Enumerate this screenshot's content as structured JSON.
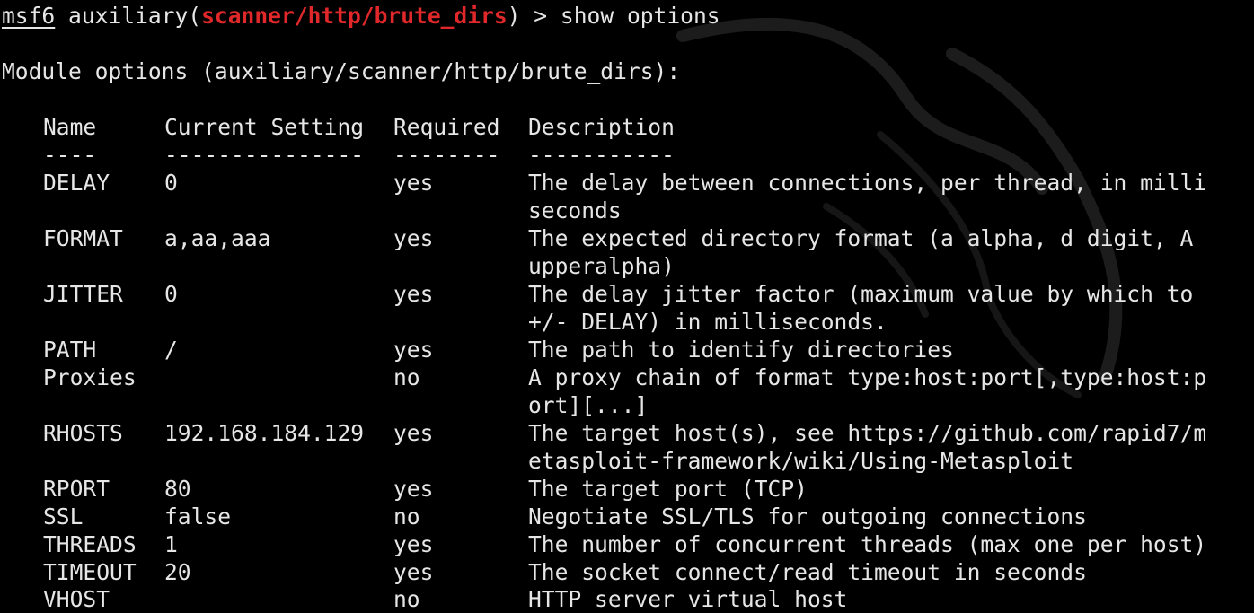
{
  "prompt": {
    "prefix": "msf6",
    "module_type": " auxiliary(",
    "module_path": "scanner/http/brute_dirs",
    "suffix": ") > ",
    "command": "show options"
  },
  "module_header": "Module options (auxiliary/scanner/http/brute_dirs):",
  "table": {
    "headers": {
      "name": "Name",
      "setting": "Current Setting",
      "required": "Required",
      "description": "Description"
    },
    "dividers": {
      "name": "----",
      "setting": "---------------",
      "required": "--------",
      "description": "-----------"
    },
    "rows": [
      {
        "name": "DELAY",
        "setting": "0",
        "required": "yes",
        "desc": [
          "The delay between connections, per thread, in milli",
          "seconds"
        ]
      },
      {
        "name": "FORMAT",
        "setting": "a,aa,aaa",
        "required": "yes",
        "desc": [
          "The expected directory format (a alpha, d digit, A",
          "upperalpha)"
        ]
      },
      {
        "name": "JITTER",
        "setting": "0",
        "required": "yes",
        "desc": [
          "The delay jitter factor (maximum value by which to",
          "+/- DELAY) in milliseconds."
        ]
      },
      {
        "name": "PATH",
        "setting": "/",
        "required": "yes",
        "desc": [
          "The path to identify directories"
        ]
      },
      {
        "name": "Proxies",
        "setting": "",
        "required": "no",
        "desc": [
          "A proxy chain of format type:host:port[,type:host:p",
          "ort][...]"
        ]
      },
      {
        "name": "RHOSTS",
        "setting": "192.168.184.129",
        "required": "yes",
        "desc": [
          "The target host(s), see https://github.com/rapid7/m",
          "etasploit-framework/wiki/Using-Metasploit"
        ]
      },
      {
        "name": "RPORT",
        "setting": "80",
        "required": "yes",
        "desc": [
          "The target port (TCP)"
        ]
      },
      {
        "name": "SSL",
        "setting": "false",
        "required": "no",
        "desc": [
          "Negotiate SSL/TLS for outgoing connections"
        ]
      },
      {
        "name": "THREADS",
        "setting": "1",
        "required": "yes",
        "desc": [
          "The number of concurrent threads (max one per host)"
        ]
      },
      {
        "name": "TIMEOUT",
        "setting": "20",
        "required": "yes",
        "desc": [
          "The socket connect/read timeout in seconds"
        ]
      },
      {
        "name": "VHOST",
        "setting": "",
        "required": "no",
        "desc": [
          "HTTP server virtual host"
        ]
      }
    ]
  },
  "colors": {
    "background": "#000000",
    "text": "#e6e6e6",
    "module_path": "#e0282a"
  },
  "icons": {
    "background": "kali-dragon-watermark"
  }
}
